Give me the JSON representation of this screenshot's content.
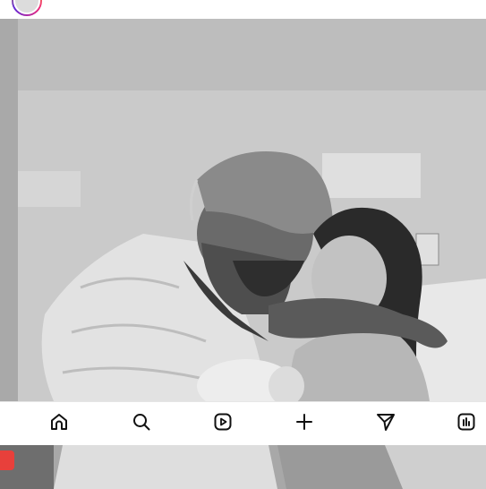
{
  "profile": {
    "avatar_icon": "profile-avatar"
  },
  "post": {
    "image_description_icon": "photo"
  },
  "nav": {
    "items": [
      {
        "icon": "home-icon"
      },
      {
        "icon": "search-icon"
      },
      {
        "icon": "reels-icon"
      },
      {
        "icon": "create-icon"
      },
      {
        "icon": "send-icon"
      },
      {
        "icon": "insights-icon"
      }
    ]
  },
  "colors": {
    "badge": "#e8403b",
    "nav_bg": "#ffffff",
    "icon": "#111111"
  }
}
